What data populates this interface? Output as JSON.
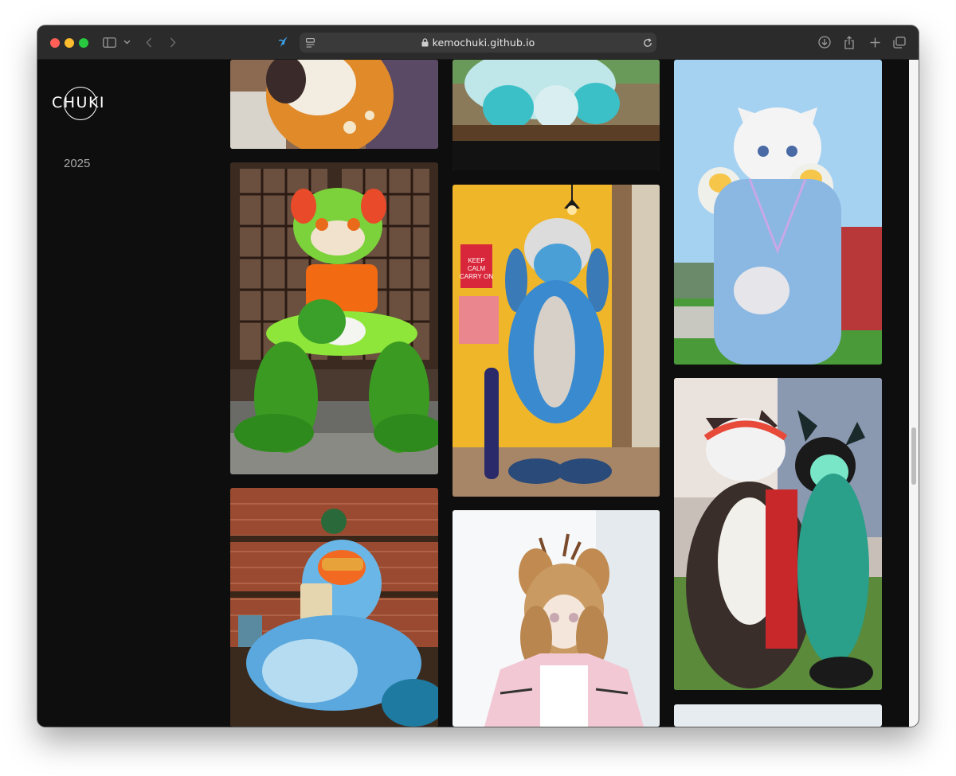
{
  "browser": {
    "url": "kemochuki.github.io"
  },
  "site": {
    "logo_text": "CHUKI",
    "nav": [
      {
        "label": "2025"
      }
    ]
  },
  "gallery": {
    "columns": [
      {
        "tiles": [
          {
            "subject": "orange and white fursuit partially visible"
          },
          {
            "subject": "green and orange fursuit seated in front of lattice doors"
          },
          {
            "subject": "blue fluffy fursuit with goggles reading in a cafe"
          }
        ]
      },
      {
        "tiles": [
          {
            "subject": "teal fluffy fursuit paws on wooden bench"
          },
          {
            "subject": "blue long-eared fursuit standing by yellow wall"
          },
          {
            "subject": "deer fursuit with antlers in pink jacket"
          }
        ]
      },
      {
        "tiles": [
          {
            "subject": "white cat fursuit in blue tracksuit outdoors"
          },
          {
            "subject": "two fursuits posing together outdoors"
          },
          {
            "subject": "next photo partially visible"
          }
        ]
      }
    ]
  }
}
